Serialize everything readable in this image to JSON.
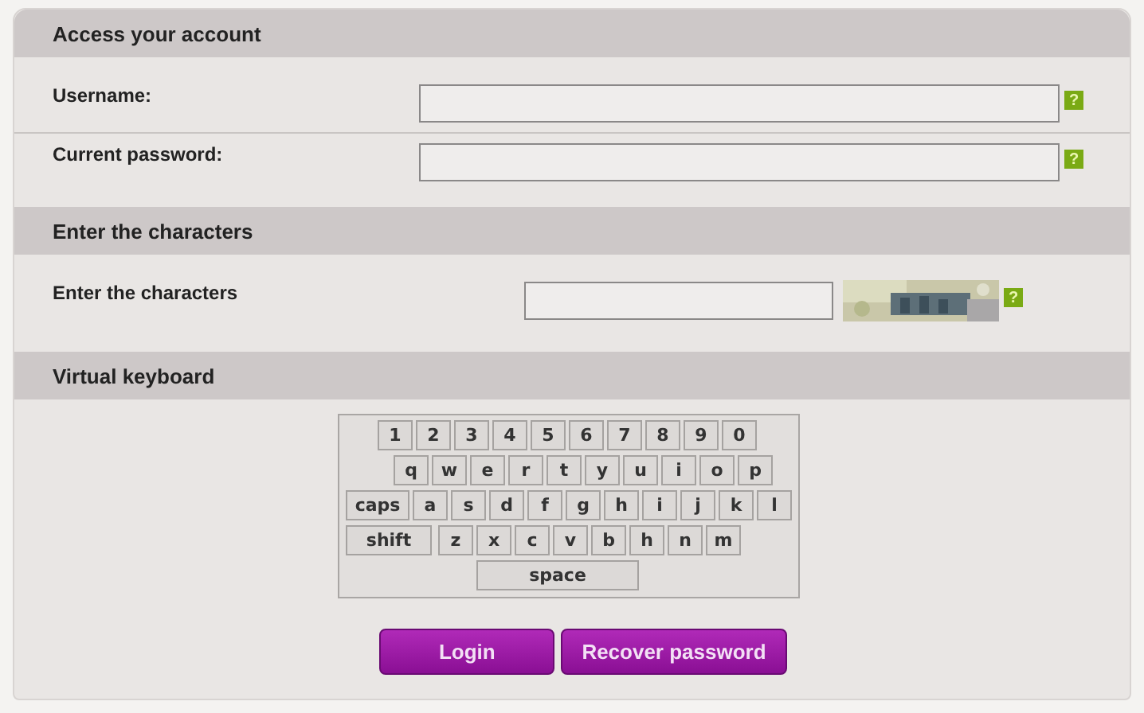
{
  "sections": [
    {
      "kind": "fields",
      "title": "Access your account",
      "fields": [
        {
          "label": "Username:",
          "help": "?"
        },
        {
          "label": "Current password:",
          "help": "?"
        }
      ]
    },
    {
      "kind": "captcha",
      "title": "Enter the characters",
      "fields": [
        {
          "label": "Enter the characters",
          "help": "?"
        }
      ]
    },
    {
      "kind": "keyboard",
      "title": "Virtual keyboard",
      "rows": [
        [
          {
            "label": "1",
            "kind": "char"
          },
          {
            "label": "2",
            "kind": "char"
          },
          {
            "label": "3",
            "kind": "char"
          },
          {
            "label": "4",
            "kind": "char"
          },
          {
            "label": "5",
            "kind": "char"
          },
          {
            "label": "6",
            "kind": "char"
          },
          {
            "label": "7",
            "kind": "char"
          },
          {
            "label": "8",
            "kind": "char"
          },
          {
            "label": "9",
            "kind": "char"
          },
          {
            "label": "0",
            "kind": "char"
          }
        ],
        [
          {
            "label": "q",
            "kind": "char"
          },
          {
            "label": "w",
            "kind": "char"
          },
          {
            "label": "e",
            "kind": "char"
          },
          {
            "label": "r",
            "kind": "char"
          },
          {
            "label": "t",
            "kind": "char"
          },
          {
            "label": "y",
            "kind": "char"
          },
          {
            "label": "u",
            "kind": "char"
          },
          {
            "label": "i",
            "kind": "char"
          },
          {
            "label": "o",
            "kind": "char"
          },
          {
            "label": "p",
            "kind": "char"
          }
        ],
        [
          {
            "label": "caps",
            "kind": "caps"
          },
          {
            "label": "a",
            "kind": "char"
          },
          {
            "label": "s",
            "kind": "char"
          },
          {
            "label": "d",
            "kind": "char"
          },
          {
            "label": "f",
            "kind": "char"
          },
          {
            "label": "g",
            "kind": "char"
          },
          {
            "label": "h",
            "kind": "char"
          },
          {
            "label": "i",
            "kind": "char"
          },
          {
            "label": "j",
            "kind": "char"
          },
          {
            "label": "k",
            "kind": "char"
          },
          {
            "label": "l",
            "kind": "char"
          }
        ],
        [
          {
            "label": "shift",
            "kind": "shift"
          },
          {
            "label": "z",
            "kind": "char"
          },
          {
            "label": "x",
            "kind": "char"
          },
          {
            "label": "c",
            "kind": "char"
          },
          {
            "label": "v",
            "kind": "char"
          },
          {
            "label": "b",
            "kind": "char"
          },
          {
            "label": "h",
            "kind": "char"
          },
          {
            "label": "n",
            "kind": "char"
          },
          {
            "label": "m",
            "kind": "char"
          }
        ]
      ],
      "space_key": {
        "label": "space",
        "kind": "space"
      }
    }
  ],
  "buttons": [
    "Login",
    "Recover password"
  ]
}
